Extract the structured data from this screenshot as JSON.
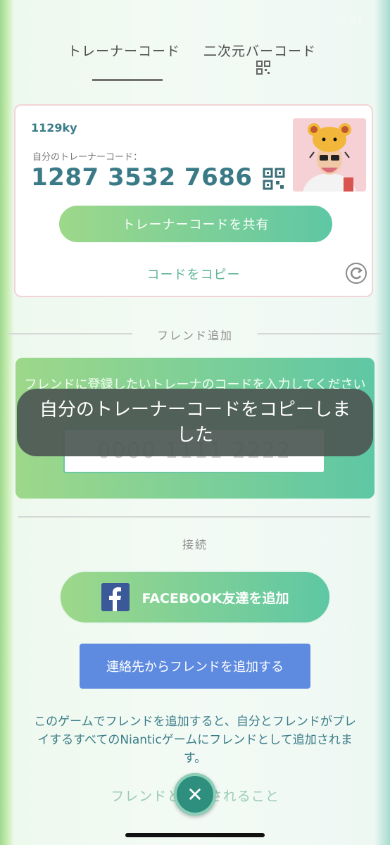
{
  "status": {
    "time": "10:03"
  },
  "tabs": [
    {
      "label": "トレーナーコード"
    },
    {
      "label": "二次元バーコード"
    }
  ],
  "card": {
    "username": "1129ky",
    "code_label": "自分のトレーナーコード：",
    "code_value": "1287 3532 7686",
    "share_label": "トレーナーコードを共有",
    "copy_label": "コードをコピー"
  },
  "friend_section": {
    "title": "フレンド追加",
    "panel_text": "フレンドに登録したいトレーナのコードを入力してください",
    "input_placeholder": "0000 1111 2222"
  },
  "toast": {
    "message": "自分のトレーナーコードをコピーしました"
  },
  "connect_section": {
    "title": "接続",
    "facebook_label": "FACEBOOK友達を追加",
    "contacts_label": "連絡先からフレンドを追加する",
    "notice": "このゲームでフレンドを追加すると、自分とフレンドがプレイするすべてのNianticゲームにフレンドとして追加されます。",
    "link_label": "フレンドとしてされること"
  },
  "colors": {
    "accent_green": "#5ec7a4",
    "teal_text": "#3a7d88",
    "facebook_blue": "#3b5998",
    "contacts_blue": "#5e8be0"
  }
}
